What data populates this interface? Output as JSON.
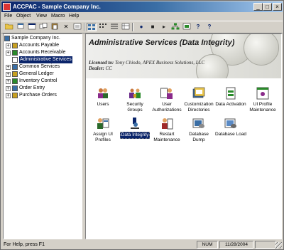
{
  "window": {
    "title": "ACCPAC - Sample Company Inc."
  },
  "menubar": [
    "File",
    "Object",
    "View",
    "Macro",
    "Help"
  ],
  "toolbar": {
    "tools": [
      "open-folder-icon",
      "new-icon",
      "cut-icon",
      "copy-icon",
      "paste-icon",
      "delete-icon",
      "properties-icon",
      "large-icons-view-icon",
      "small-icons-view-icon",
      "list-view-icon",
      "details-view-icon",
      "record-icon",
      "stop-icon",
      "play-icon",
      "tree-icon",
      "macro-edit-icon",
      "help-icon",
      "whats-this-icon"
    ]
  },
  "tree": {
    "root": "Sample Company Inc.",
    "items": [
      {
        "label": "Accounts Payable",
        "expander": "+",
        "selected": false
      },
      {
        "label": "Accounts Receivable",
        "expander": "+",
        "selected": false
      },
      {
        "label": "Administrative Services",
        "expander": "",
        "selected": true
      },
      {
        "label": "Common Services",
        "expander": "+",
        "selected": false
      },
      {
        "label": "General Ledger",
        "expander": "+",
        "selected": false
      },
      {
        "label": "Inventory Control",
        "expander": "+",
        "selected": false
      },
      {
        "label": "Order Entry",
        "expander": "+",
        "selected": false
      },
      {
        "label": "Purchase Orders",
        "expander": "+",
        "selected": false
      }
    ]
  },
  "content": {
    "title": "Administrative Services (Data Integrity)",
    "licensed_label": "Licensed to:",
    "licensed_to": "Tony Chiodo, APEX Business Solutions, LLC",
    "dealer_label": "Dealer:",
    "dealer": "CC",
    "icons": [
      {
        "label": "Users",
        "icon": "users-icon"
      },
      {
        "label": "Security Groups",
        "icon": "security-groups-icon"
      },
      {
        "label": "User Authorizations",
        "icon": "user-authorizations-icon"
      },
      {
        "label": "Customization Directories",
        "icon": "customization-directories-icon"
      },
      {
        "label": "Data Activation",
        "icon": "data-activation-icon"
      },
      {
        "label": "UI Profile Maintenance",
        "icon": "ui-profile-maintenance-icon"
      },
      {
        "label": "Assign UI Profiles",
        "icon": "assign-ui-profiles-icon"
      },
      {
        "label": "Data Integrity",
        "icon": "data-integrity-icon",
        "selected": true
      },
      {
        "label": "Restart Maintenance",
        "icon": "restart-maintenance-icon"
      },
      {
        "label": "Database Dump",
        "icon": "database-dump-icon"
      },
      {
        "label": "Database Load",
        "icon": "database-load-icon"
      }
    ]
  },
  "status": {
    "help": "For Help, press F1",
    "num": "NUM",
    "date": "11/28/2004"
  },
  "colors": {
    "titlebar": "#0a246a",
    "face": "#d4d0c8",
    "selection": "#0a246a"
  }
}
